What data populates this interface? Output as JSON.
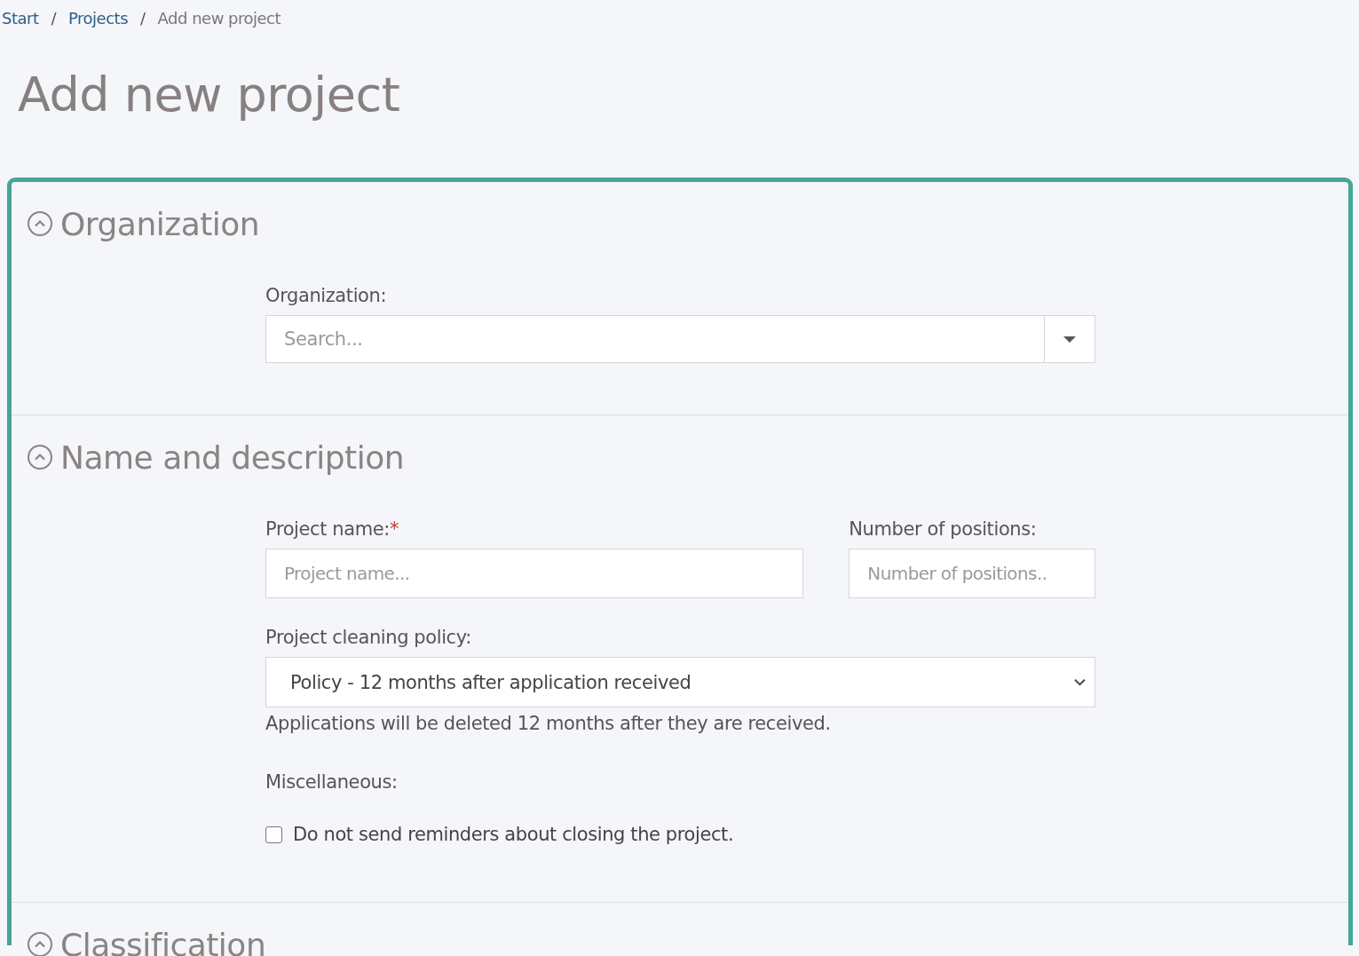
{
  "breadcrumb": [
    {
      "label": "Start",
      "kind": "link"
    },
    {
      "label": "/",
      "kind": "separator"
    },
    {
      "label": "Projects",
      "kind": "link"
    },
    {
      "label": "/",
      "kind": "separator"
    },
    {
      "label": "Add new project",
      "kind": "current"
    }
  ],
  "title": "Add new project",
  "sections": [
    {
      "title": "Organization",
      "expanded": true,
      "fields": [
        {
          "kind": "combo",
          "label": "Organization:",
          "placeholder": "Search..."
        }
      ]
    },
    {
      "title": "Name and description",
      "expanded": true,
      "fields": [
        {
          "kind": "row",
          "items": [
            {
              "label": "Project name:",
              "required_mark": "*",
              "placeholder": "Project name..."
            },
            {
              "label": "Number of positions:",
              "placeholder": "Number of positions.."
            }
          ]
        },
        {
          "kind": "select",
          "label": "Project cleaning policy:",
          "value": "Policy - 12 months after application received",
          "help": "Applications will be deleted 12 months after they are received."
        },
        {
          "kind": "checkgroup",
          "label": "Miscellaneous:",
          "options": [
            {
              "label": "Do not send reminders about closing the project.",
              "checked": false
            }
          ]
        }
      ]
    },
    {
      "title": "Classification",
      "expanded": true
    }
  ]
}
